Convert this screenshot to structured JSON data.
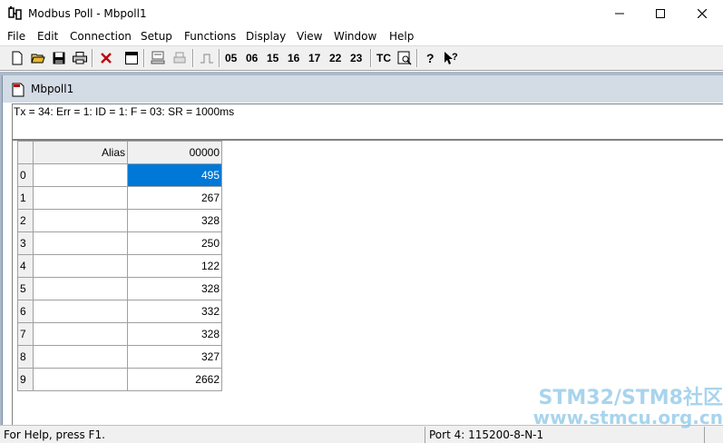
{
  "window": {
    "title": "Modbus Poll - Mbpoll1"
  },
  "menu": [
    "File",
    "Edit",
    "Connection",
    "Setup",
    "Functions",
    "Display",
    "View",
    "Window",
    "Help"
  ],
  "toolbar": {
    "function_codes": [
      "05",
      "06",
      "15",
      "16",
      "17",
      "22",
      "23"
    ],
    "tc_label": "TC"
  },
  "child": {
    "title": "Mbpoll1",
    "status": "Tx = 34: Err = 1: ID = 1: F = 03: SR = 1000ms"
  },
  "grid": {
    "headers": {
      "alias": "Alias",
      "col": "00000"
    },
    "rows": [
      {
        "index": "0",
        "alias": "",
        "value": "495"
      },
      {
        "index": "1",
        "alias": "",
        "value": "267"
      },
      {
        "index": "2",
        "alias": "",
        "value": "328"
      },
      {
        "index": "3",
        "alias": "",
        "value": "250"
      },
      {
        "index": "4",
        "alias": "",
        "value": "122"
      },
      {
        "index": "5",
        "alias": "",
        "value": "328"
      },
      {
        "index": "6",
        "alias": "",
        "value": "332"
      },
      {
        "index": "7",
        "alias": "",
        "value": "328"
      },
      {
        "index": "8",
        "alias": "",
        "value": "327"
      },
      {
        "index": "9",
        "alias": "",
        "value": "2662"
      }
    ],
    "selected_row": 0
  },
  "statusbar": {
    "help": "For Help, press F1.",
    "port": "Port 4: 115200-8-N-1"
  },
  "watermark": {
    "line1": "STM32/STM8社区",
    "line2": "www.stmcu.org.cn"
  },
  "colors": {
    "selection": "#0078d7",
    "mdi_background": "#abb9c9",
    "child_title": "#d3dbe5"
  }
}
